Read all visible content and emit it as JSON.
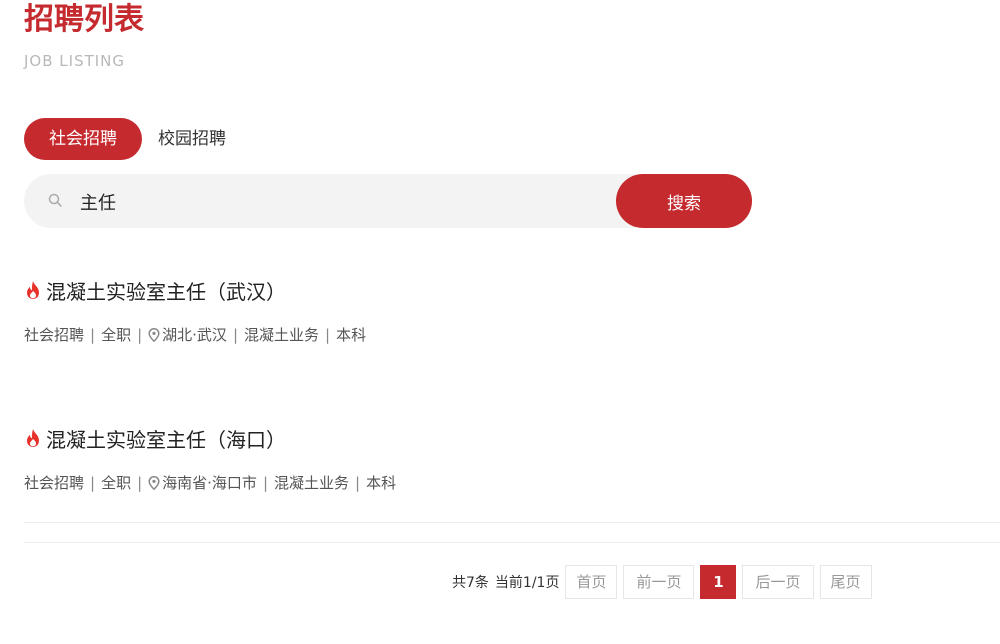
{
  "header": {
    "title": "招聘列表",
    "subtitle": "JOB LISTING"
  },
  "tabs": [
    {
      "label": "社会招聘",
      "active": true
    },
    {
      "label": "校园招聘",
      "active": false
    }
  ],
  "search": {
    "value": "主任",
    "placeholder": "",
    "button_label": "搜索"
  },
  "jobs": [
    {
      "title": "混凝土实验室主任（武汉）",
      "type": "社会招聘",
      "employment": "全职",
      "location": "湖北·武汉",
      "department": "混凝土业务",
      "education": "本科"
    },
    {
      "title": "混凝土实验室主任（海口）",
      "type": "社会招聘",
      "employment": "全职",
      "location": "海南省·海口市",
      "department": "混凝土业务",
      "education": "本科"
    }
  ],
  "meta_separator": "|",
  "pagination": {
    "total": "共7条",
    "current": "当前1/1页",
    "first": "首页",
    "prev": "前一页",
    "page": "1",
    "next": "后一页",
    "last": "尾页"
  },
  "colors": {
    "accent": "#c52a2f",
    "search_bg": "#f3f3f3",
    "subtitle": "#b8b8b8"
  }
}
